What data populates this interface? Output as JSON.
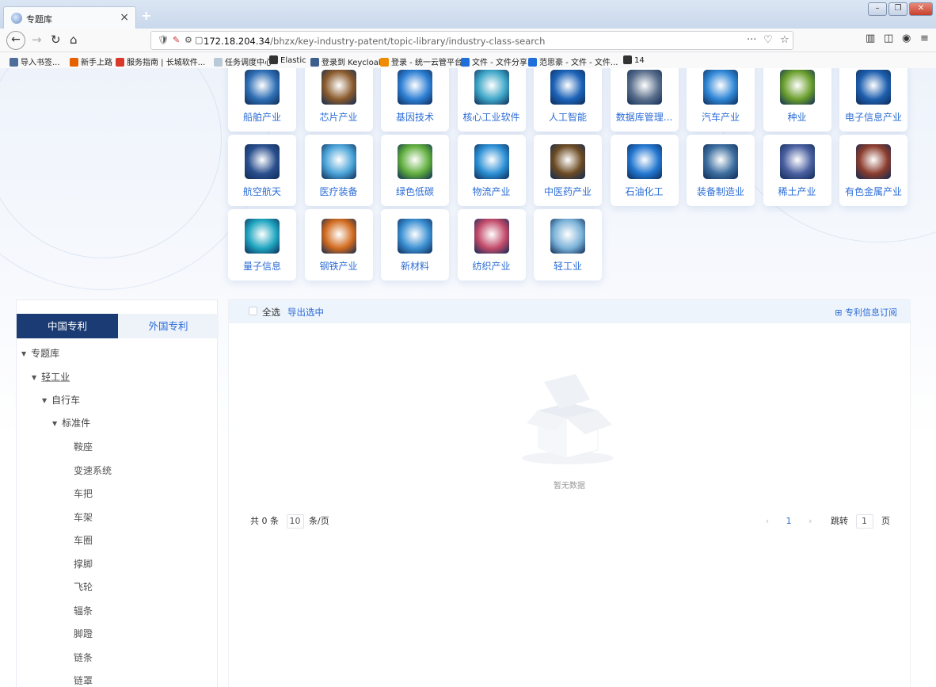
{
  "browser": {
    "tab_title": "专题库",
    "tab_close": "×",
    "new_tab": "+",
    "url_host": "172.18.204.34",
    "url_path": "/bhzx/key-industry-patent/topic-library/industry-class-search",
    "url_more": "···"
  },
  "bookmarks": [
    {
      "label": "导入书签...",
      "color": "#4d6d9a"
    },
    {
      "label": "新手上路",
      "color": "#e66000"
    },
    {
      "label": "服务指南 | 长城软件...",
      "color": "#d8392b"
    },
    {
      "label": "任务调度中心",
      "color": "#b9c9d8"
    },
    {
      "label": "Elastic",
      "color": "#333333"
    },
    {
      "label": "登录到 Keycloak",
      "color": "#3d5d8c"
    },
    {
      "label": "登录 - 统一云管平台",
      "color": "#f08a00"
    },
    {
      "label": "文件 - 文件分享",
      "color": "#1e6fd9"
    },
    {
      "label": "范思豪 - 文件 - 文件...",
      "color": "#1e6fd9"
    },
    {
      "label": "14",
      "color": "#333333"
    }
  ],
  "industry_cards": [
    {
      "label": "船舶产业",
      "color": "#2f6fb5"
    },
    {
      "label": "芯片产业",
      "color": "#8a5a2c"
    },
    {
      "label": "基因技术",
      "color": "#2d7fd4"
    },
    {
      "label": "核心工业软件",
      "color": "#3ea6c8"
    },
    {
      "label": "人工智能",
      "color": "#1c63b8"
    },
    {
      "label": "数据库管理...",
      "color": "#5a6f8c"
    },
    {
      "label": "汽车产业",
      "color": "#2f86d6"
    },
    {
      "label": "种业",
      "color": "#6a9e2c"
    },
    {
      "label": "电子信息产业",
      "color": "#1e5fae"
    },
    {
      "label": "航空航天",
      "color": "#2a4f8e"
    },
    {
      "label": "医疗装备",
      "color": "#4aa3d8"
    },
    {
      "label": "绿色低碳",
      "color": "#5fae3c"
    },
    {
      "label": "物流产业",
      "color": "#2b8fd4"
    },
    {
      "label": "中医药产业",
      "color": "#6b4a22"
    },
    {
      "label": "石油化工",
      "color": "#2276d0"
    },
    {
      "label": "装备制造业",
      "color": "#3c6d9e"
    },
    {
      "label": "稀土产业",
      "color": "#4a5fa0"
    },
    {
      "label": "有色金属产业",
      "color": "#8a3c2c"
    },
    {
      "label": "量子信息",
      "color": "#1fa5c0"
    },
    {
      "label": "钢铁产业",
      "color": "#d16a1e"
    },
    {
      "label": "新材料",
      "color": "#3a8fd2"
    },
    {
      "label": "纺织产业",
      "color": "#c24a6a"
    },
    {
      "label": "轻工业",
      "color": "#7ab2d8"
    }
  ],
  "tree": {
    "tab_china": "中国专利",
    "tab_foreign": "外国专利",
    "root": "专题库",
    "level1": "轻工业",
    "level2": "自行车",
    "level3": "标准件",
    "leaves": [
      "鞍座",
      "变速系统",
      "车把",
      "车架",
      "车圈",
      "撑脚",
      "飞轮",
      "辐条",
      "脚蹬",
      "链条",
      "链罩"
    ]
  },
  "results": {
    "select_all": "全选",
    "export": "导出选中",
    "subscribe": "专利信息订阅",
    "empty": "暂无数据",
    "total": "共 0 条",
    "page_size": "10",
    "per_page": "条/页",
    "prev": "‹",
    "current_page": "1",
    "next": "›",
    "jump": "跳转",
    "jump_value": "1",
    "page_unit": "页"
  }
}
